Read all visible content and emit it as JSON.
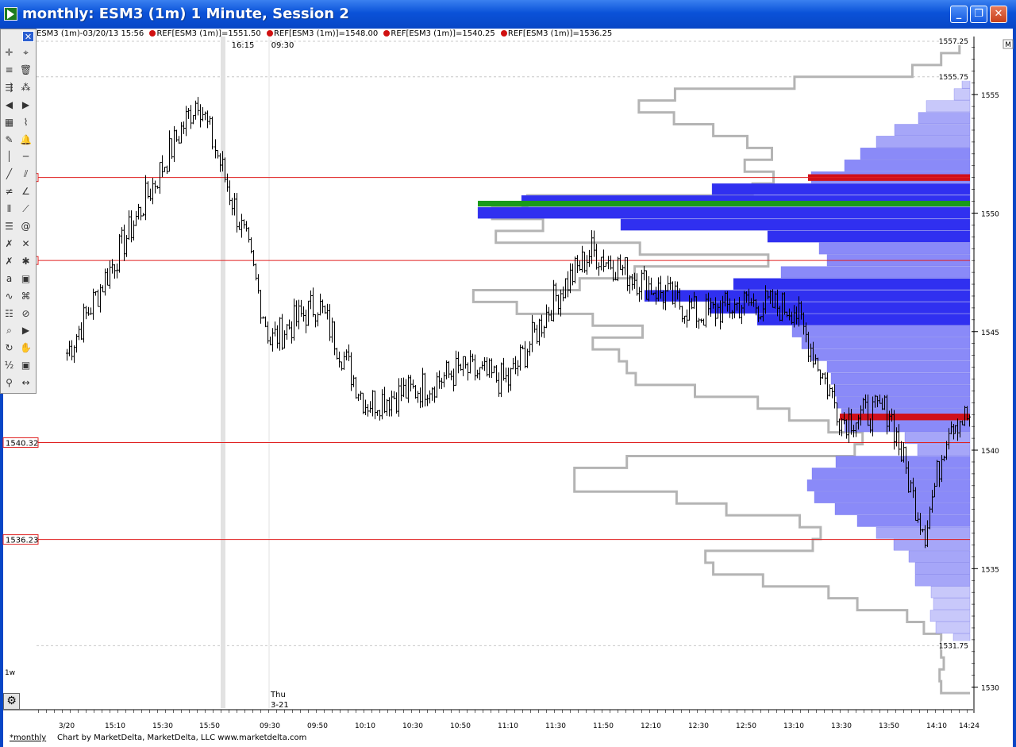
{
  "window": {
    "title": "monthly: ESM3 (1m) 1 Minute, Session 2",
    "minimize": "_",
    "maximize": "❐",
    "close": "✕"
  },
  "header": {
    "symbol_info": "ESM3 (1m)-03/20/13 15:56",
    "refs": [
      "REF[ESM3 (1m)]=1551.50",
      "REF[ESM3 (1m)]=1548.00",
      "REF[ESM3 (1m)]=1540.25",
      "REF[ESM3 (1m)]=1536.25"
    ]
  },
  "toolbar": {
    "close": "✕",
    "tools": [
      {
        "icon": "crosshair-xyz-icon",
        "glyph": "✛"
      },
      {
        "icon": "draw-xyz-icon",
        "glyph": "⌖"
      },
      {
        "icon": "list-lines-icon",
        "glyph": "≡"
      },
      {
        "icon": "trash-icon",
        "glyph": "🗑"
      },
      {
        "icon": "link-lines-icon",
        "glyph": "⇶"
      },
      {
        "icon": "xyz-icon",
        "glyph": "⁂"
      },
      {
        "icon": "arrow-left-icon",
        "glyph": "◀"
      },
      {
        "icon": "arrow-right-icon",
        "glyph": "▶"
      },
      {
        "icon": "bar-chart-icon",
        "glyph": "▦"
      },
      {
        "icon": "line-chart-icon",
        "glyph": "⌇"
      },
      {
        "icon": "pen-icon",
        "glyph": "✎"
      },
      {
        "icon": "bell-icon",
        "glyph": "🔔"
      },
      {
        "icon": "vertical-line-icon",
        "glyph": "│"
      },
      {
        "icon": "horizontal-line-icon",
        "glyph": "─"
      },
      {
        "icon": "trendline-icon",
        "glyph": "╱"
      },
      {
        "icon": "parallel-lines-icon",
        "glyph": "⫽"
      },
      {
        "icon": "channel-icon",
        "glyph": "≠"
      },
      {
        "icon": "angle-icon",
        "glyph": "∠"
      },
      {
        "icon": "fib-time-icon",
        "glyph": "⦀"
      },
      {
        "icon": "fib-fan-icon",
        "glyph": "⟋"
      },
      {
        "icon": "fib-retrace-icon",
        "glyph": "☰"
      },
      {
        "icon": "spiral-icon",
        "glyph": "@"
      },
      {
        "icon": "gann-icon",
        "glyph": "✗"
      },
      {
        "icon": "gann-fan-icon",
        "glyph": "✕"
      },
      {
        "icon": "cross-tool-icon",
        "glyph": "✗"
      },
      {
        "icon": "bug-icon",
        "glyph": "✱"
      },
      {
        "icon": "text-icon",
        "glyph": "a"
      },
      {
        "icon": "box-icon",
        "glyph": "▣"
      },
      {
        "icon": "study-icon",
        "glyph": "∿"
      },
      {
        "icon": "ibm-symbol-icon",
        "glyph": "⌘"
      },
      {
        "icon": "notes-icon",
        "glyph": "☷"
      },
      {
        "icon": "alert-icon",
        "glyph": "⊘"
      },
      {
        "icon": "zoom-icon",
        "glyph": "⌕"
      },
      {
        "icon": "play-icon",
        "glyph": "▶"
      },
      {
        "icon": "refresh-icon",
        "glyph": "↻"
      },
      {
        "icon": "hand-icon",
        "glyph": "✋"
      },
      {
        "icon": "fraction-icon",
        "glyph": "½"
      },
      {
        "icon": "camera-icon",
        "glyph": "▣"
      },
      {
        "icon": "magnify-icon",
        "glyph": "⚲"
      },
      {
        "icon": "expand-icon",
        "glyph": "↔"
      }
    ]
  },
  "chart_data": {
    "type": "candlestick",
    "symbol": "ESM3 (1m)",
    "price_axis": {
      "ylim": [
        1529.25,
        1557.25
      ],
      "ticks": [
        "1555",
        "1550",
        "1545",
        "1540",
        "1535",
        "1530"
      ],
      "special_labels": [
        "1557.25",
        "1555.75",
        "1531.75"
      ],
      "top_badge": "M"
    },
    "time_axis": {
      "ticks": [
        "3/20",
        "15:10",
        "15:30",
        "15:50",
        "09:30",
        "09:50",
        "10:10",
        "10:30",
        "10:50",
        "11:10",
        "11:30",
        "11:50",
        "12:10",
        "12:30",
        "12:50",
        "13:10",
        "13:30",
        "13:50",
        "14:10",
        "14:24"
      ],
      "session_marks": [
        "16:15",
        "09:30"
      ],
      "day_label": [
        "Thu",
        "3-21"
      ],
      "period_label": "1w"
    },
    "reference_lines": [
      {
        "price": 1551.5,
        "label": ""
      },
      {
        "price": 1548.0,
        "label": ""
      },
      {
        "price": 1540.32,
        "label": "1540.32"
      },
      {
        "price": 1536.23,
        "label": "1536.23"
      }
    ],
    "key_anchor_points": [
      {
        "time": "3/20 15:00",
        "price": 1544.1
      },
      {
        "time": "3/20 15:45",
        "price": 1554.9
      },
      {
        "time": "3/20 16:15",
        "price": 1548.7
      },
      {
        "time": "09:30",
        "price": 1544.6
      },
      {
        "time": "09:50",
        "price": 1546.2
      },
      {
        "time": "10:10",
        "price": 1542.0
      },
      {
        "time": "10:30",
        "price": 1542.5
      },
      {
        "time": "10:50",
        "price": 1543.4
      },
      {
        "time": "11:10",
        "price": 1542.9
      },
      {
        "time": "11:30",
        "price": 1546.5
      },
      {
        "time": "11:45",
        "price": 1548.4
      },
      {
        "time": "12:05",
        "price": 1547.2
      },
      {
        "time": "12:30",
        "price": 1545.7
      },
      {
        "time": "12:50",
        "price": 1546.2
      },
      {
        "time": "13:10",
        "price": 1546.0
      },
      {
        "time": "13:30",
        "price": 1541.3
      },
      {
        "time": "13:50",
        "price": 1541.7
      },
      {
        "time": "14:00",
        "price": 1538.0
      },
      {
        "time": "14:05",
        "price": 1536.6
      },
      {
        "time": "14:15",
        "price": 1541.2
      },
      {
        "time": "14:24",
        "price": 1541.4
      }
    ],
    "composite_profile": {
      "poc_price": 1550.4,
      "poc_color": "#1a9a1a",
      "hvn_color": "#3030f0",
      "body_color": "#8a8af8",
      "light_color": "#c8c8fa",
      "session_poc_prices": [
        1551.5,
        1541.4
      ],
      "session_poc_color": "#d0101a",
      "levels": [
        {
          "price": 1555.5,
          "volume": 10
        },
        {
          "price": 1555.0,
          "volume": 20
        },
        {
          "price": 1554.5,
          "volume": 55
        },
        {
          "price": 1554.0,
          "volume": 65
        },
        {
          "price": 1553.5,
          "volume": 95
        },
        {
          "price": 1553.0,
          "volume": 118
        },
        {
          "price": 1552.5,
          "volume": 138
        },
        {
          "price": 1552.0,
          "volume": 158
        },
        {
          "price": 1551.5,
          "volume": 200
        },
        {
          "price": 1551.0,
          "volume": 325
        },
        {
          "price": 1550.5,
          "volume": 565
        },
        {
          "price": 1550.0,
          "volume": 620
        },
        {
          "price": 1549.5,
          "volume": 440
        },
        {
          "price": 1549.0,
          "volume": 255
        },
        {
          "price": 1548.5,
          "volume": 190
        },
        {
          "price": 1548.0,
          "volume": 180
        },
        {
          "price": 1547.5,
          "volume": 238
        },
        {
          "price": 1547.0,
          "volume": 298
        },
        {
          "price": 1546.5,
          "volume": 410
        },
        {
          "price": 1546.0,
          "volume": 328
        },
        {
          "price": 1545.5,
          "volume": 268
        },
        {
          "price": 1545.0,
          "volume": 224
        },
        {
          "price": 1544.5,
          "volume": 212
        },
        {
          "price": 1544.0,
          "volume": 200
        },
        {
          "price": 1543.5,
          "volume": 180
        },
        {
          "price": 1543.0,
          "volume": 175
        },
        {
          "price": 1542.5,
          "volume": 170
        },
        {
          "price": 1542.0,
          "volume": 168
        },
        {
          "price": 1541.5,
          "volume": 162
        },
        {
          "price": 1541.0,
          "volume": 158
        },
        {
          "price": 1540.5,
          "volume": 82
        },
        {
          "price": 1540.0,
          "volume": 66
        },
        {
          "price": 1539.5,
          "volume": 169
        },
        {
          "price": 1539.0,
          "volume": 199
        },
        {
          "price": 1538.5,
          "volume": 205
        },
        {
          "price": 1538.0,
          "volume": 196
        },
        {
          "price": 1537.5,
          "volume": 170
        },
        {
          "price": 1537.0,
          "volume": 142
        },
        {
          "price": 1536.5,
          "volume": 118
        },
        {
          "price": 1536.0,
          "volume": 96
        },
        {
          "price": 1535.5,
          "volume": 77
        },
        {
          "price": 1535.0,
          "volume": 69
        },
        {
          "price": 1534.5,
          "volume": 69
        },
        {
          "price": 1534.0,
          "volume": 49
        },
        {
          "price": 1533.5,
          "volume": 46
        },
        {
          "price": 1533.0,
          "volume": 50
        },
        {
          "price": 1532.5,
          "volume": 43
        },
        {
          "price": 1532.0,
          "volume": 21
        }
      ]
    },
    "prior_profile_outline": {
      "color": "#b4b4b4",
      "levels": [
        {
          "price": 1557.0,
          "volume": 20
        },
        {
          "price": 1556.5,
          "volume": 55
        },
        {
          "price": 1556.0,
          "volume": 110
        },
        {
          "price": 1555.5,
          "volume": 335
        },
        {
          "price": 1555.0,
          "volume": 563
        },
        {
          "price": 1554.5,
          "volume": 632
        },
        {
          "price": 1554.0,
          "volume": 565
        },
        {
          "price": 1553.5,
          "volume": 490
        },
        {
          "price": 1553.0,
          "volume": 425
        },
        {
          "price": 1552.5,
          "volume": 378
        },
        {
          "price": 1552.0,
          "volume": 430
        },
        {
          "price": 1551.5,
          "volume": 375
        },
        {
          "price": 1551.0,
          "volume": 415
        },
        {
          "price": 1550.5,
          "volume": 845
        },
        {
          "price": 1550.0,
          "volume": 912
        },
        {
          "price": 1549.5,
          "volume": 815
        },
        {
          "price": 1549.0,
          "volume": 905
        },
        {
          "price": 1548.5,
          "volume": 630
        },
        {
          "price": 1548.0,
          "volume": 385
        },
        {
          "price": 1547.5,
          "volume": 640
        },
        {
          "price": 1547.0,
          "volume": 745
        },
        {
          "price": 1546.5,
          "volume": 948
        },
        {
          "price": 1546.0,
          "volume": 865
        },
        {
          "price": 1545.5,
          "volume": 720
        },
        {
          "price": 1545.0,
          "volume": 625
        },
        {
          "price": 1544.5,
          "volume": 720
        },
        {
          "price": 1544.0,
          "volume": 670
        },
        {
          "price": 1543.5,
          "volume": 655
        },
        {
          "price": 1543.0,
          "volume": 638
        },
        {
          "price": 1542.5,
          "volume": 525
        },
        {
          "price": 1542.0,
          "volume": 405
        },
        {
          "price": 1541.5,
          "volume": 345
        },
        {
          "price": 1541.0,
          "volume": 270
        },
        {
          "price": 1540.5,
          "volume": 205
        },
        {
          "price": 1540.0,
          "volume": 220
        },
        {
          "price": 1539.5,
          "volume": 655
        },
        {
          "price": 1539.0,
          "volume": 755
        },
        {
          "price": 1538.5,
          "volume": 755
        },
        {
          "price": 1538.0,
          "volume": 560
        },
        {
          "price": 1537.5,
          "volume": 465
        },
        {
          "price": 1537.0,
          "volume": 325
        },
        {
          "price": 1536.5,
          "volume": 285
        },
        {
          "price": 1536.0,
          "volume": 300
        },
        {
          "price": 1535.5,
          "volume": 505
        },
        {
          "price": 1535.0,
          "volume": 490
        },
        {
          "price": 1534.5,
          "volume": 395
        },
        {
          "price": 1534.0,
          "volume": 270
        },
        {
          "price": 1533.5,
          "volume": 215
        },
        {
          "price": 1533.0,
          "volume": 120
        },
        {
          "price": 1532.5,
          "volume": 88
        },
        {
          "price": 1532.0,
          "volume": 55
        },
        {
          "price": 1531.5,
          "volume": 55
        },
        {
          "price": 1531.0,
          "volume": 50
        },
        {
          "price": 1530.5,
          "volume": 58
        },
        {
          "price": 1530.0,
          "volume": 55
        }
      ]
    }
  },
  "status": {
    "chart_name": "*monthly",
    "credit": "Chart by MarketDelta, MarketDelta, LLC www.marketdelta.com"
  }
}
